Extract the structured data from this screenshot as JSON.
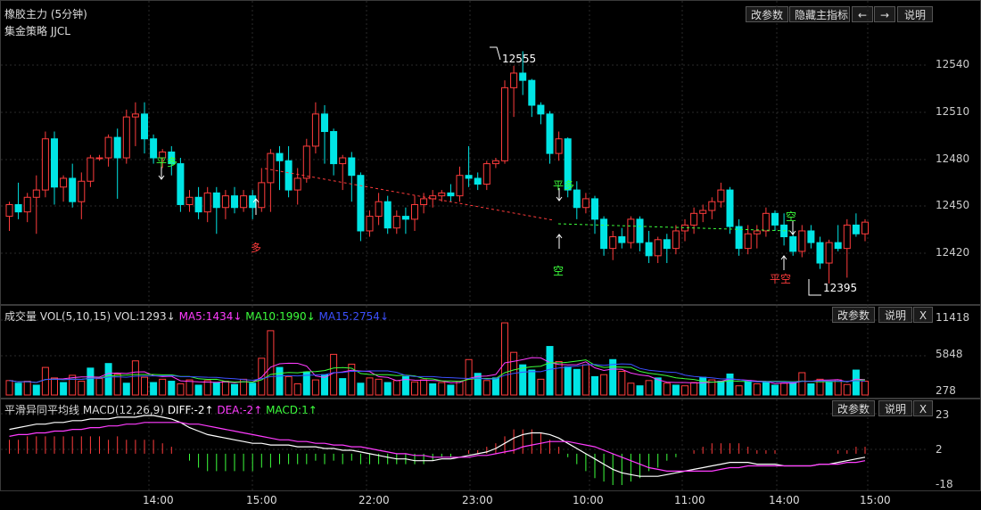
{
  "main_panel": {
    "title": "橡胶主力 (5分钟)",
    "strategy_label": "集金策略 JJCL",
    "buttons": {
      "params": "改参数",
      "hide_indicator": "隐藏主指标",
      "prev": "←",
      "next": "→",
      "help": "说明"
    },
    "y_ticks": [
      "12540",
      "12510",
      "12480",
      "12450",
      "12420"
    ],
    "high_marker": "12555",
    "low_marker": "12395",
    "signals": {
      "close_long_1": "平多",
      "long_1": "多",
      "close_long_2": "平多",
      "short_1": "空",
      "short_2": "空",
      "close_short": "平空"
    }
  },
  "volume_panel": {
    "label": "成交量",
    "params": "VOL(5,10,15)",
    "vol": "VOL:1293↓",
    "ma5": "MA5:1434↓",
    "ma10": "MA10:1990↓",
    "ma15": "MA15:2754↓",
    "buttons": {
      "params": "改参数",
      "help": "说明",
      "close": "X"
    },
    "y_ticks": [
      "11418",
      "5848",
      "278"
    ]
  },
  "macd_panel": {
    "label": "平滑异同平均线",
    "params": "MACD(12,26,9)",
    "diff": "DIFF:-2↑",
    "dea": "DEA:-2↑",
    "macd": "MACD:1↑",
    "buttons": {
      "params": "改参数",
      "help": "说明",
      "close": "X"
    },
    "y_ticks": [
      "23",
      "2",
      "-18"
    ]
  },
  "time_axis": [
    "14:00",
    "15:00",
    "22:00",
    "23:00",
    "10:00",
    "11:00",
    "14:00",
    "15:00"
  ],
  "colors": {
    "up": "#ff3c3c",
    "down": "#00e5e5",
    "ma5": "#ff3cff",
    "ma10": "#3cff3c",
    "ma15": "#3c50ff",
    "diff": "#ffffff",
    "dea": "#ff3cff",
    "signal_green": "#3cff3c",
    "signal_red": "#ff3c3c"
  },
  "chart_data": [
    {
      "type": "candlestick",
      "title": "橡胶主力 (5分钟)",
      "ylim": [
        12385,
        12565
      ],
      "x_labels": [
        "14:00",
        "15:00",
        "22:00",
        "23:00",
        "10:00",
        "11:00",
        "14:00",
        "15:00"
      ],
      "ohlc": [
        [
          12442,
          12452,
          12432,
          12450
        ],
        [
          12450,
          12465,
          12440,
          12445
        ],
        [
          12445,
          12458,
          12438,
          12455
        ],
        [
          12455,
          12470,
          12430,
          12460
        ],
        [
          12460,
          12500,
          12455,
          12495
        ],
        [
          12495,
          12500,
          12450,
          12462
        ],
        [
          12462,
          12470,
          12452,
          12468
        ],
        [
          12468,
          12478,
          12448,
          12452
        ],
        [
          12452,
          12472,
          12440,
          12466
        ],
        [
          12466,
          12484,
          12462,
          12482
        ],
        [
          12482,
          12484,
          12480,
          12482
        ],
        [
          12482,
          12498,
          12476,
          12496
        ],
        [
          12496,
          12502,
          12454,
          12482
        ],
        [
          12482,
          12515,
          12478,
          12510
        ],
        [
          12510,
          12520,
          12490,
          12512
        ],
        [
          12512,
          12520,
          12485,
          12495
        ],
        [
          12495,
          12498,
          12478,
          12482
        ],
        [
          12482,
          12488,
          12475,
          12486
        ],
        [
          12486,
          12490,
          12470,
          12478
        ],
        [
          12478,
          12482,
          12445,
          12450
        ],
        [
          12450,
          12460,
          12445,
          12455
        ],
        [
          12455,
          12462,
          12440,
          12445
        ],
        [
          12445,
          12462,
          12438,
          12458
        ],
        [
          12458,
          12462,
          12430,
          12448
        ],
        [
          12448,
          12460,
          12440,
          12456
        ],
        [
          12456,
          12462,
          12444,
          12448
        ],
        [
          12448,
          12460,
          12445,
          12456
        ],
        [
          12456,
          12460,
          12440,
          12448
        ],
        [
          12448,
          12475,
          12445,
          12465
        ],
        [
          12465,
          12488,
          12445,
          12485
        ],
        [
          12485,
          12490,
          12460,
          12480
        ],
        [
          12480,
          12490,
          12455,
          12460
        ],
        [
          12460,
          12475,
          12450,
          12468
        ],
        [
          12468,
          12495,
          12465,
          12490
        ],
        [
          12490,
          12520,
          12485,
          12512
        ],
        [
          12512,
          12518,
          12478,
          12500
        ],
        [
          12500,
          12502,
          12470,
          12478
        ],
        [
          12478,
          12484,
          12460,
          12482
        ],
        [
          12482,
          12486,
          12452,
          12470
        ],
        [
          12470,
          12472,
          12425,
          12432
        ],
        [
          12432,
          12446,
          12428,
          12442
        ],
        [
          12442,
          12458,
          12436,
          12452
        ],
        [
          12452,
          12456,
          12430,
          12434
        ],
        [
          12434,
          12446,
          12430,
          12442
        ],
        [
          12442,
          12448,
          12430,
          12440
        ],
        [
          12440,
          12456,
          12432,
          12450
        ],
        [
          12450,
          12458,
          12444,
          12454
        ],
        [
          12454,
          12460,
          12448,
          12456
        ],
        [
          12456,
          12460,
          12452,
          12458
        ],
        [
          12458,
          12464,
          12452,
          12456
        ],
        [
          12456,
          12476,
          12452,
          12470
        ],
        [
          12470,
          12490,
          12462,
          12468
        ],
        [
          12468,
          12472,
          12460,
          12464
        ],
        [
          12464,
          12480,
          12460,
          12478
        ],
        [
          12478,
          12482,
          12475,
          12480
        ],
        [
          12480,
          12535,
          12478,
          12530
        ],
        [
          12530,
          12545,
          12510,
          12540
        ],
        [
          12540,
          12555,
          12525,
          12535
        ],
        [
          12535,
          12536,
          12510,
          12518
        ],
        [
          12518,
          12520,
          12505,
          12512
        ],
        [
          12512,
          12514,
          12478,
          12485
        ],
        [
          12485,
          12500,
          12480,
          12495
        ],
        [
          12495,
          12496,
          12455,
          12460
        ],
        [
          12460,
          12466,
          12440,
          12448
        ],
        [
          12448,
          12458,
          12444,
          12454
        ],
        [
          12454,
          12456,
          12430,
          12440
        ],
        [
          12440,
          12442,
          12415,
          12420
        ],
        [
          12420,
          12432,
          12412,
          12428
        ],
        [
          12428,
          12434,
          12420,
          12424
        ],
        [
          12424,
          12442,
          12420,
          12440
        ],
        [
          12440,
          12442,
          12418,
          12424
        ],
        [
          12424,
          12432,
          12410,
          12415
        ],
        [
          12415,
          12428,
          12410,
          12426
        ],
        [
          12426,
          12430,
          12410,
          12420
        ],
        [
          12420,
          12436,
          12416,
          12432
        ],
        [
          12432,
          12440,
          12425,
          12436
        ],
        [
          12436,
          12448,
          12430,
          12444
        ],
        [
          12444,
          12450,
          12438,
          12446
        ],
        [
          12446,
          12455,
          12440,
          12452
        ],
        [
          12452,
          12465,
          12448,
          12460
        ],
        [
          12460,
          12462,
          12430,
          12435
        ],
        [
          12435,
          12440,
          12415,
          12420
        ],
        [
          12420,
          12436,
          12416,
          12430
        ],
        [
          12430,
          12436,
          12420,
          12432
        ],
        [
          12432,
          12448,
          12428,
          12444
        ],
        [
          12444,
          12446,
          12432,
          12436
        ],
        [
          12436,
          12444,
          12422,
          12428
        ],
        [
          12428,
          12432,
          12415,
          12418
        ],
        [
          12418,
          12436,
          12414,
          12432
        ],
        [
          12432,
          12436,
          12420,
          12424
        ],
        [
          12424,
          12428,
          12406,
          12410
        ],
        [
          12410,
          12426,
          12396,
          12424
        ],
        [
          12424,
          12436,
          12418,
          12420
        ],
        [
          12420,
          12440,
          12400,
          12436
        ],
        [
          12436,
          12444,
          12428,
          12430
        ],
        [
          12430,
          12440,
          12425,
          12438
        ]
      ]
    },
    {
      "type": "bar",
      "title": "VOL(5,10,15)",
      "ylim": [
        0,
        11418
      ],
      "values": [
        2200,
        1800,
        2100,
        1500,
        4200,
        2600,
        1900,
        3000,
        2100,
        4100,
        2500,
        4800,
        3200,
        1800,
        5200,
        2700,
        1900,
        2400,
        2100,
        1700,
        2300,
        1500,
        2200,
        1900,
        2100,
        1600,
        2400,
        1800,
        5600,
        9800,
        4200,
        2800,
        1700,
        3500,
        2300,
        3100,
        6200,
        2500,
        4700,
        1800,
        2600,
        2400,
        1900,
        2200,
        2800,
        2000,
        2300,
        1700,
        1900,
        1500,
        2100,
        5400,
        3300,
        2200,
        2600,
        11000,
        6500,
        4600,
        3800,
        2400,
        7400,
        5100,
        4300,
        3900,
        4600,
        2800,
        3100,
        5400,
        3600,
        1800,
        1400,
        2200,
        2600,
        1800,
        1500,
        1400,
        1900,
        2700,
        2300,
        2100,
        3200,
        1400,
        2200,
        1700,
        1900,
        1500,
        1800,
        2000,
        3400,
        1700,
        2400,
        1900,
        2300,
        1600,
        3800,
        2100
      ],
      "up_mask": [
        1,
        0,
        1,
        0,
        1,
        1,
        0,
        1,
        1,
        0,
        1,
        0,
        1,
        0,
        1,
        1,
        0,
        1,
        0,
        1,
        1,
        0,
        1,
        0,
        1,
        0,
        1,
        0,
        1,
        1,
        0,
        1,
        1,
        0,
        1,
        0,
        1,
        0,
        1,
        0,
        1,
        1,
        0,
        1,
        0,
        1,
        1,
        0,
        1,
        0,
        1,
        1,
        0,
        1,
        0,
        1,
        1,
        0,
        0,
        1,
        0,
        1,
        0,
        0,
        1,
        0,
        1,
        0,
        1,
        1,
        0,
        1,
        0,
        1,
        0,
        1,
        1,
        0,
        1,
        0,
        0,
        1,
        0,
        1,
        0,
        0,
        1,
        0,
        1,
        0,
        1,
        0,
        1,
        1,
        0,
        1
      ]
    },
    {
      "type": "line",
      "title": "MACD(12,26,9)",
      "ylim": [
        -18,
        23
      ],
      "series": [
        {
          "name": "DIFF",
          "values": [
            14,
            15,
            16,
            17,
            17,
            18,
            18,
            19,
            19,
            20,
            20,
            20,
            21,
            21,
            21,
            22,
            22,
            21,
            20,
            18,
            15,
            13,
            11,
            10,
            9,
            8,
            7,
            6,
            6,
            5,
            5,
            5,
            4,
            4,
            4,
            3,
            3,
            2,
            2,
            1,
            0,
            -1,
            -2,
            -3,
            -3,
            -4,
            -4,
            -4,
            -3,
            -3,
            -2,
            -1,
            0,
            1,
            3,
            6,
            9,
            11,
            12,
            12,
            11,
            9,
            6,
            3,
            0,
            -3,
            -6,
            -9,
            -11,
            -12,
            -13,
            -13,
            -13,
            -12,
            -11,
            -10,
            -9,
            -8,
            -7,
            -6,
            -5,
            -5,
            -5,
            -6,
            -6,
            -6,
            -7,
            -7,
            -7,
            -7,
            -6,
            -6,
            -5,
            -4,
            -3,
            -2
          ]
        },
        {
          "name": "DEA",
          "values": [
            10,
            11,
            11,
            12,
            12,
            13,
            13,
            14,
            14,
            15,
            15,
            16,
            16,
            17,
            17,
            18,
            18,
            18,
            18,
            18,
            17,
            17,
            16,
            15,
            14,
            13,
            12,
            11,
            10,
            9,
            8,
            8,
            7,
            7,
            6,
            6,
            5,
            5,
            4,
            4,
            3,
            2,
            1,
            0,
            0,
            -1,
            -1,
            -2,
            -2,
            -2,
            -2,
            -2,
            -1,
            -1,
            0,
            1,
            2,
            4,
            5,
            6,
            7,
            7,
            7,
            6,
            5,
            4,
            2,
            0,
            -2,
            -4,
            -6,
            -8,
            -9,
            -10,
            -10,
            -10,
            -10,
            -10,
            -10,
            -9,
            -8,
            -8,
            -7,
            -7,
            -7,
            -7,
            -7,
            -7,
            -7,
            -7,
            -6,
            -6,
            -6,
            -5,
            -5,
            -4
          ]
        }
      ]
    }
  ]
}
